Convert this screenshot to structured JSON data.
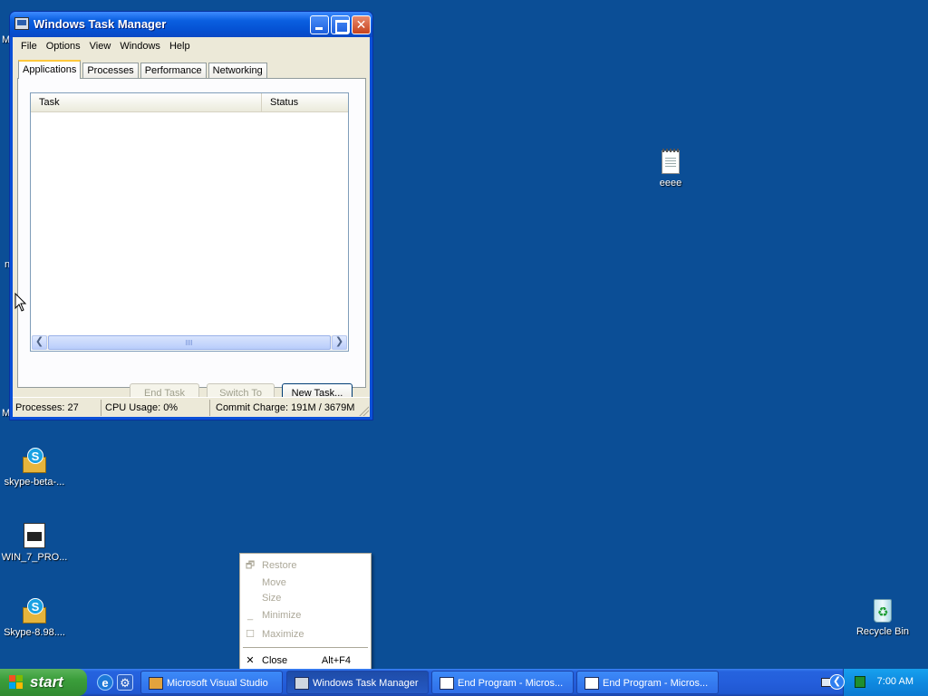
{
  "colors": {
    "desktop": "#0b4e96",
    "titlebar": "#0552d4",
    "taskbar": "#245edb",
    "start": "#3b9e3b",
    "tray": "#0f8ae0"
  },
  "desktop": {
    "icons": [
      {
        "label": "eeee",
        "icon": "notepad-icon"
      },
      {
        "label": "skype-beta-...",
        "icon": "skype-package-icon"
      },
      {
        "label": "WIN_7_PRO...",
        "icon": "document-icon"
      },
      {
        "label": "Skype-8.98....",
        "icon": "skype-package-icon"
      },
      {
        "label": "Recycle Bin",
        "icon": "recycle-bin-icon"
      }
    ],
    "edge_fragments": [
      "M",
      "n",
      "M"
    ]
  },
  "window": {
    "title": "Windows Task Manager",
    "menu": [
      "File",
      "Options",
      "View",
      "Windows",
      "Help"
    ],
    "tabs": [
      "Applications",
      "Processes",
      "Performance",
      "Networking"
    ],
    "active_tab": "Applications",
    "columns": [
      "Task",
      "Status"
    ],
    "buttons": {
      "end_task": "End Task",
      "switch_to": "Switch To",
      "new_task": "New Task..."
    },
    "status": {
      "processes": "Processes: 27",
      "cpu": "CPU Usage: 0%",
      "commit": "Commit Charge: 191M / 3679M"
    }
  },
  "context_menu": {
    "items": [
      {
        "label": "Restore",
        "glyph": "restore-glyph",
        "enabled": false
      },
      {
        "label": "Move",
        "enabled": false
      },
      {
        "label": "Size",
        "enabled": false
      },
      {
        "label": "Minimize",
        "glyph": "minimize-glyph",
        "enabled": false
      },
      {
        "label": "Maximize",
        "glyph": "maximize-glyph",
        "enabled": false
      },
      {
        "label": "Close",
        "glyph": "close-glyph",
        "shortcut": "Alt+F4",
        "enabled": true
      }
    ]
  },
  "taskbar": {
    "start_label": "start",
    "buttons": [
      {
        "label": "Microsoft Visual Studio",
        "icon": "visual-studio-icon"
      },
      {
        "label": "Windows Task Manager",
        "icon": "task-manager-icon",
        "active": true
      },
      {
        "label": "End Program - Micros...",
        "icon": "window-icon"
      },
      {
        "label": "End Program - Micros...",
        "icon": "window-icon"
      }
    ],
    "clock": "7:00 AM"
  }
}
